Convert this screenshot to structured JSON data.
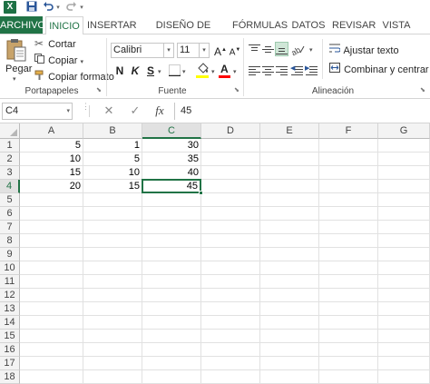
{
  "quick_access": {
    "app_icon": "excel-logo",
    "app_letter": "X",
    "icons": [
      "save-icon",
      "undo-icon",
      "redo-icon",
      "customize-icon"
    ]
  },
  "tabs": [
    {
      "label": "ARCHIVO"
    },
    {
      "label": "INICIO"
    },
    {
      "label": "INSERTAR"
    },
    {
      "label": "DISEÑO DE PÁGINA"
    },
    {
      "label": "FÓRMULAS"
    },
    {
      "label": "DATOS"
    },
    {
      "label": "REVISAR"
    },
    {
      "label": "VISTA"
    }
  ],
  "ribbon": {
    "clipboard": {
      "paste_label": "Pegar",
      "cut_label": "Cortar",
      "copy_label": "Copiar",
      "format_painter_label": "Copiar formato",
      "group_label": "Portapapeles"
    },
    "font": {
      "font_name": "Calibri",
      "font_size": "11",
      "bold": "N",
      "italic": "K",
      "underline": "S",
      "grow": "A",
      "shrink": "A",
      "font_color_letter": "A",
      "group_label": "Fuente",
      "fill_color": "#ffff00",
      "text_color": "#ff0000"
    },
    "alignment": {
      "wrap_text_label": "Ajustar texto",
      "merge_center_label": "Combinar y centrar",
      "group_label": "Alineación"
    }
  },
  "formula_bar": {
    "name_box": "C4",
    "cancel_glyph": "✕",
    "enter_glyph": "✓",
    "fx_label": "fx",
    "value": "45"
  },
  "sheet": {
    "columns": [
      "A",
      "B",
      "C",
      "D",
      "E",
      "F",
      "G"
    ],
    "rows": [
      "1",
      "2",
      "3",
      "4",
      "5",
      "6",
      "7",
      "8",
      "9",
      "10",
      "11",
      "12",
      "13",
      "14",
      "15",
      "16",
      "17",
      "18"
    ],
    "selected_cell": "C4",
    "data": [
      [
        "5",
        "1",
        "30"
      ],
      [
        "10",
        "5",
        "35"
      ],
      [
        "15",
        "10",
        "40"
      ],
      [
        "20",
        "15",
        "45"
      ]
    ]
  },
  "colors": {
    "excel_green": "#217346",
    "header_bg": "#f3f3f3",
    "grid_line": "#e1e1e1"
  }
}
